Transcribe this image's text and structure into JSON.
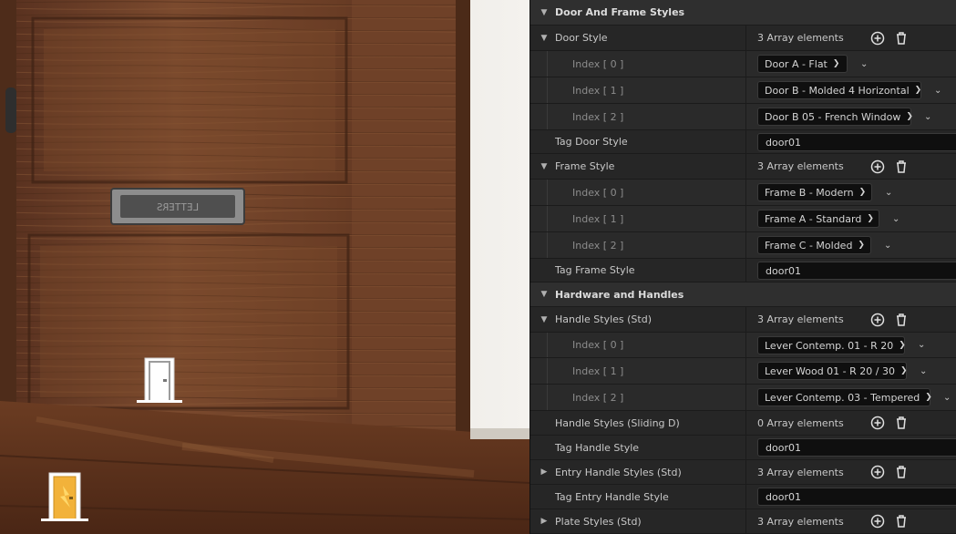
{
  "details": {
    "categories": {
      "door_frame": "Door And Frame Styles",
      "hardware": "Hardware and Handles"
    },
    "door_style": {
      "label": "Door Style",
      "count": "3 Array elements",
      "items": [
        {
          "index": "Index [ 0 ]",
          "value": "Door A - Flat"
        },
        {
          "index": "Index [ 1 ]",
          "value": "Door B - Molded 4 Horizontal"
        },
        {
          "index": "Index [ 2 ]",
          "value": "Door B 05 - French Window"
        }
      ]
    },
    "tag_door_style": {
      "label": "Tag Door Style",
      "value": "door01"
    },
    "frame_style": {
      "label": "Frame Style",
      "count": "3 Array elements",
      "items": [
        {
          "index": "Index [ 0 ]",
          "value": "Frame B - Modern"
        },
        {
          "index": "Index [ 1 ]",
          "value": "Frame A - Standard"
        },
        {
          "index": "Index [ 2 ]",
          "value": "Frame C - Molded"
        }
      ]
    },
    "tag_frame_style": {
      "label": "Tag Frame Style",
      "value": "door01"
    },
    "handle_styles_std": {
      "label": "Handle Styles (Std)",
      "count": "3 Array elements",
      "items": [
        {
          "index": "Index [ 0 ]",
          "value": "Lever Contemp. 01 - R 20"
        },
        {
          "index": "Index [ 1 ]",
          "value": "Lever Wood 01 - R 20 / 30"
        },
        {
          "index": "Index [ 2 ]",
          "value": "Lever Contemp. 03 - Tempered"
        }
      ]
    },
    "handle_styles_sliding": {
      "label": "Handle Styles (Sliding D)",
      "count": "0 Array elements"
    },
    "tag_handle_style": {
      "label": "Tag Handle Style",
      "value": "door01"
    },
    "entry_handle_styles": {
      "label": "Entry Handle Styles (Std)",
      "count": "3 Array elements"
    },
    "tag_entry_handle_style": {
      "label": "Tag Entry Handle Style",
      "value": "door01"
    },
    "plate_styles": {
      "label": "Plate Styles (Std)",
      "count": "3 Array elements"
    }
  },
  "viewport": {
    "letter_plate_text": "LETTERS",
    "icons": [
      "door-icon",
      "door-icon-selected"
    ]
  },
  "colors": {
    "panel_bg": "#242424",
    "category_bg": "#2f2f2f",
    "field_bg": "#0f0f0f",
    "wood": "#6e4128"
  }
}
